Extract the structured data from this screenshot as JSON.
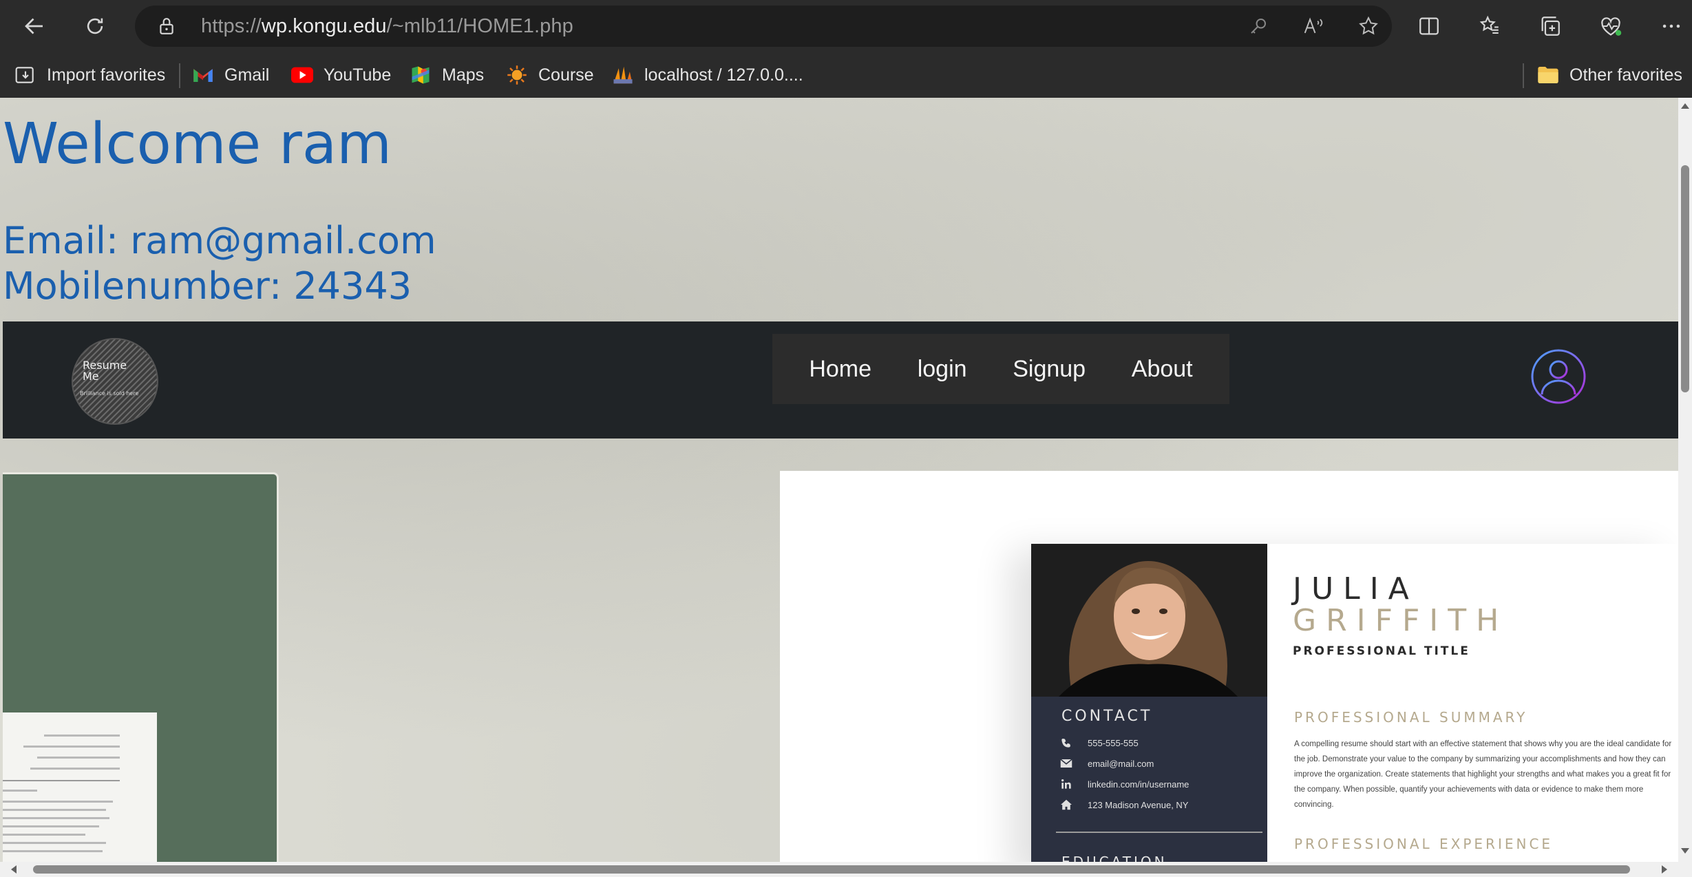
{
  "browser": {
    "url_prefix": "https://",
    "url_domain": "wp.kongu.edu",
    "url_path": "/~mlb11/HOME1.php",
    "favorites": [
      {
        "label": "Import favorites",
        "icon": "import-icon"
      },
      {
        "label": "Gmail",
        "icon": "gmail-icon"
      },
      {
        "label": "YouTube",
        "icon": "youtube-icon"
      },
      {
        "label": "Maps",
        "icon": "maps-icon"
      },
      {
        "label": "Course",
        "icon": "course-icon"
      },
      {
        "label": "localhost / 127.0.0....",
        "icon": "phpmyadmin-icon"
      }
    ],
    "other_favorites": "Other favorites"
  },
  "page": {
    "welcome": "Welcome ram",
    "email_label": "Email:",
    "email_value": "ram@gmail.com",
    "mobile_label": "Mobilenumber:",
    "mobile_value": "24343",
    "logo_title_1": "Resume",
    "logo_title_2": "Me",
    "logo_tagline": "Brilliance is sold here",
    "nav": {
      "home": "Home",
      "login": "login",
      "signup": "Signup",
      "about": "About"
    }
  },
  "resume": {
    "first_name": "JULIA",
    "last_name": "GRIFFITH",
    "title": "PROFESSIONAL TITLE",
    "contact_heading": "CONTACT",
    "phone": "555-555-555",
    "email": "email@mail.com",
    "linkedin": "linkedin.com/in/username",
    "address": "123 Madison Avenue, NY",
    "education_heading": "EDUCATION",
    "summary_heading": "PROFESSIONAL SUMMARY",
    "summary_text": "A compelling resume should start with an effective statement that shows why you are the ideal candidate for the job. Demonstrate your value to the company by summarizing your accomplishments and how they can improve the organization. Create statements that highlight your strengths and what makes you a great fit for the company. When possible, quantify your achievements with data or evidence to make them more convincing.",
    "experience_heading": "PROFESSIONAL EXPERIENCE"
  },
  "colors": {
    "accent_text": "#1a5fae",
    "nav_band": "#202427",
    "resume_gold": "#b5a98e"
  }
}
